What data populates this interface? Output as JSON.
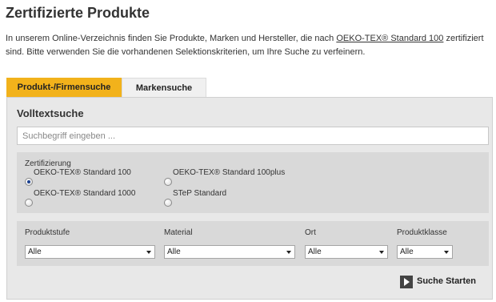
{
  "page": {
    "title": "Zertifizierte Produkte",
    "intro_part1": "In unserem Online-Verzeichnis finden Sie Produkte, Marken und Hersteller, die nach ",
    "intro_link": "OEKO-TEX® Standard 100",
    "intro_part2": " zertifiziert sind. Bitte verwenden Sie die vorhandenen Selektionskriterien, um Ihre Suche zu verfeinern."
  },
  "tabs": [
    {
      "label": "Produkt-/Firmensuche",
      "active": true
    },
    {
      "label": "Markensuche",
      "active": false
    }
  ],
  "search": {
    "heading": "Volltextsuche",
    "placeholder": "Suchbegriff eingeben ..."
  },
  "certification": {
    "label": "Zertifizierung",
    "options": [
      {
        "label": "OEKO-TEX® Standard 100",
        "checked": true
      },
      {
        "label": "OEKO-TEX® Standard 100plus",
        "checked": false
      },
      {
        "label": "OEKO-TEX® Standard 1000",
        "checked": false
      },
      {
        "label": "STeP Standard",
        "checked": false
      }
    ]
  },
  "filters": [
    {
      "label": "Produktstufe",
      "value": "Alle"
    },
    {
      "label": "Material",
      "value": "Alle"
    },
    {
      "label": "Ort",
      "value": "Alle"
    },
    {
      "label": "Produktklasse",
      "value": "Alle"
    }
  ],
  "actions": {
    "search_start_label": "Suche Starten"
  },
  "colors": {
    "accent": "#f2b21b",
    "panel_bg": "#e8e8e8",
    "section_bg": "#d9d9d9"
  }
}
